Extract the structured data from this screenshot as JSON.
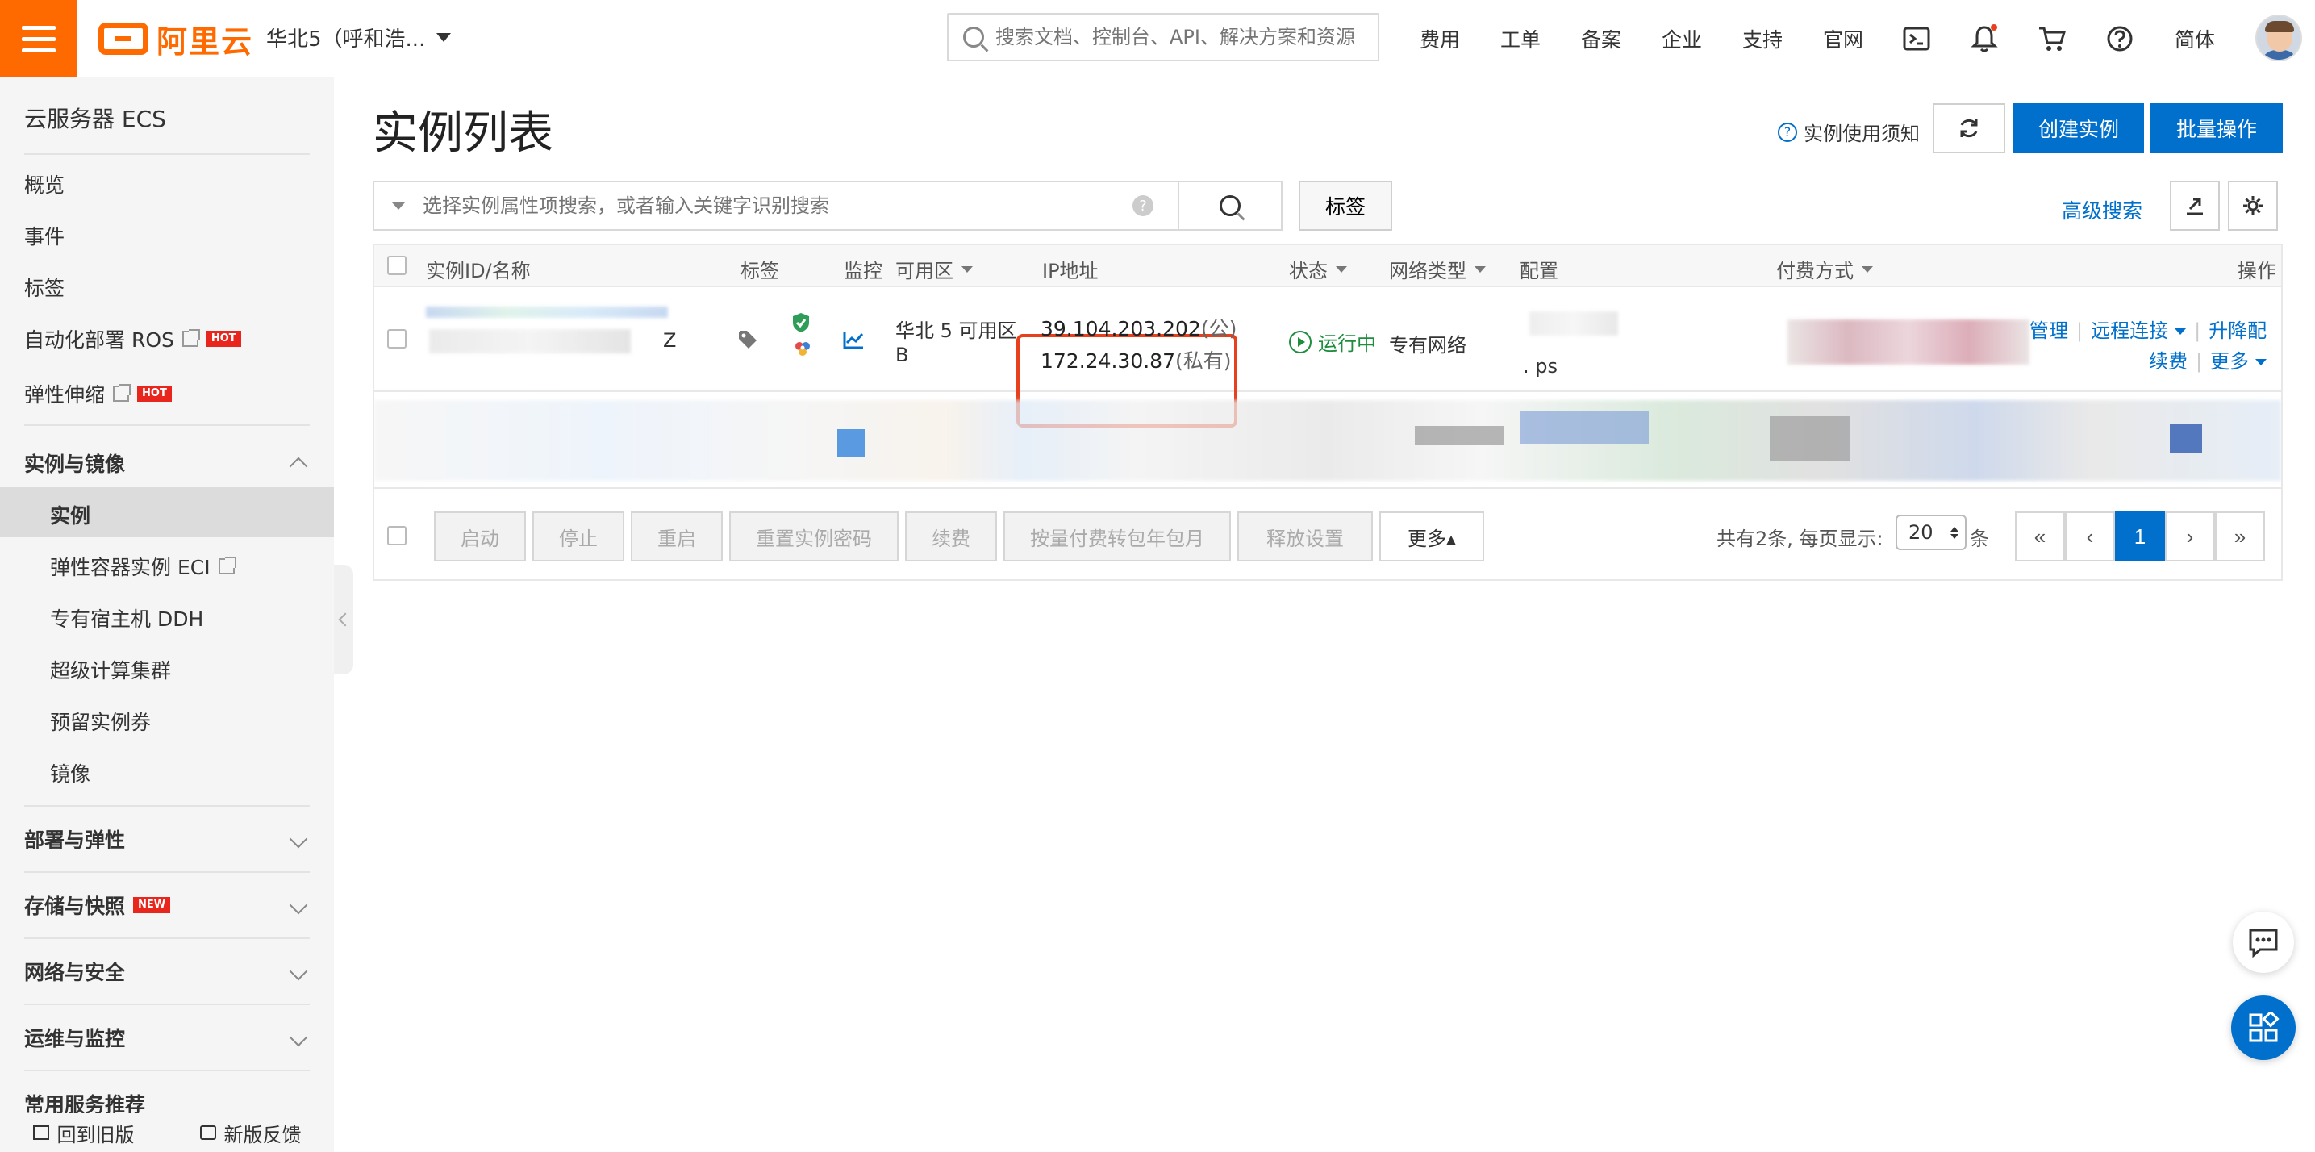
{
  "header": {
    "logo_text": "阿里云",
    "region": "华北5（呼和浩...",
    "search_placeholder": "搜索文档、控制台、API、解决方案和资源",
    "nav": [
      "费用",
      "工单",
      "备案",
      "企业",
      "支持",
      "官网"
    ],
    "lang": "简体"
  },
  "sidebar": {
    "title": "云服务器 ECS",
    "top_items": [
      {
        "label": "概览"
      },
      {
        "label": "事件"
      },
      {
        "label": "标签"
      },
      {
        "label": "自动化部署 ROS",
        "badge": "HOT"
      },
      {
        "label": "弹性伸缩",
        "badge": "HOT"
      }
    ],
    "group_instances": "实例与镜像",
    "sub_items": [
      {
        "label": "实例",
        "active": true
      },
      {
        "label": "弹性容器实例 ECI"
      },
      {
        "label": "专有宿主机 DDH"
      },
      {
        "label": "超级计算集群"
      },
      {
        "label": "预留实例券"
      },
      {
        "label": "镜像"
      }
    ],
    "groups": [
      {
        "label": "部署与弹性"
      },
      {
        "label": "存储与快照",
        "badge": "NEW"
      },
      {
        "label": "网络与安全"
      },
      {
        "label": "运维与监控"
      },
      {
        "label": "常用服务推荐"
      }
    ],
    "footer": {
      "back_old": "回到旧版",
      "feedback": "新版反馈"
    }
  },
  "main": {
    "title": "实例列表",
    "notice": "实例使用须知",
    "create_label": "创建实例",
    "batch_label": "批量操作",
    "filter_placeholder": "选择实例属性项搜索，或者输入关键字识别搜索",
    "tag_label": "标签",
    "advanced_search": "高级搜索",
    "columns": [
      "实例ID/名称",
      "标签",
      "监控",
      "可用区",
      "IP地址",
      "状态",
      "网络类型",
      "配置",
      "付费方式",
      "操作"
    ],
    "row1": {
      "zone_line1": "华北 5 可用区",
      "zone_line2": "B",
      "ip_public": "39.104.203.202",
      "ip_public_suffix": "(公)",
      "ip_private": "172.24.30.87",
      "ip_private_suffix": "(私有)",
      "status": "运行中",
      "network": "专有网络",
      "config_tail": "ps",
      "name_tail": "Z",
      "actions": {
        "manage": "管理",
        "remote": "远程连接",
        "upgrade": "升降配",
        "renew": "续费",
        "more": "更多"
      }
    },
    "bulk_actions": [
      "启动",
      "停止",
      "重启",
      "重置实例密码",
      "续费",
      "按量付费转包年包月",
      "释放设置"
    ],
    "more_label": "更多▴",
    "pagination": {
      "total_text": "共有2条, 每页显示:",
      "page_size": "20",
      "unit": "条",
      "first": "«",
      "prev": "‹",
      "current": "1",
      "next": "›",
      "last": "»"
    }
  },
  "colors": {
    "brand_orange": "#ff6a00",
    "primary_blue": "#0070cc",
    "highlight_red": "#e8401c",
    "running_green": "#1e8e3e"
  }
}
